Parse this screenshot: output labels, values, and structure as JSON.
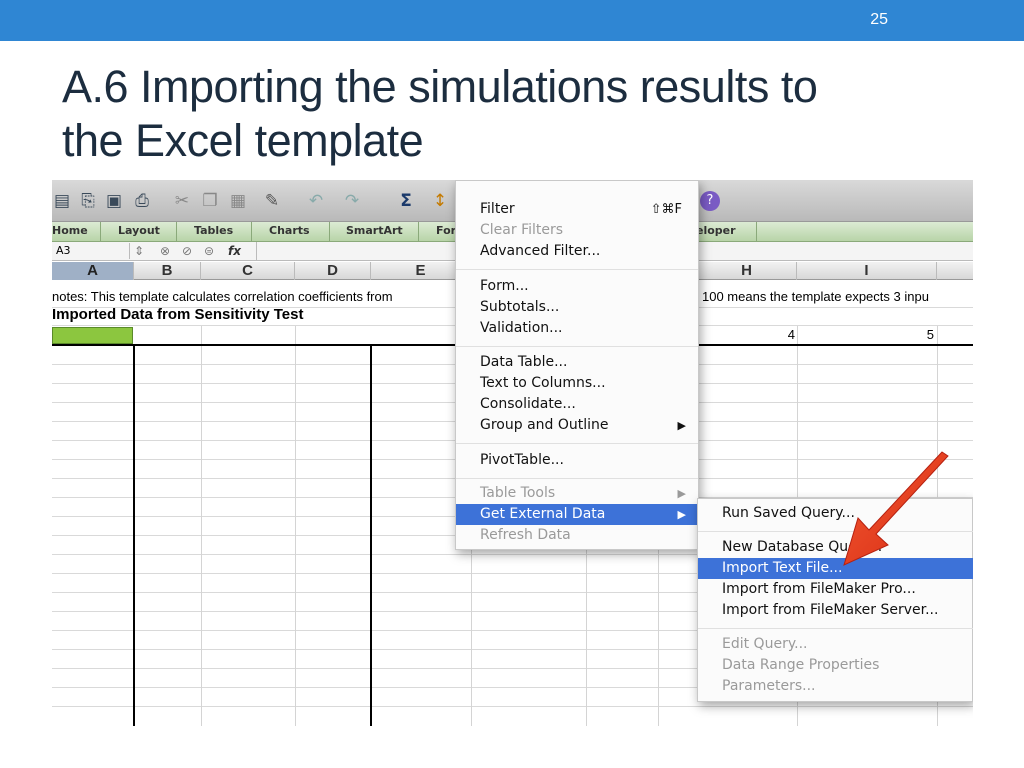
{
  "slide": {
    "number": "25",
    "title_line1": "A.6 Importing the simulations results to",
    "title_line2": "the Excel template",
    "accent_color": "#2f86d3"
  },
  "toolbar": {
    "icons": [
      "sheet-icon",
      "open-icon",
      "save-icon",
      "print-icon",
      "cut-icon",
      "copy-icon",
      "paste-icon",
      "format-brush-icon",
      "undo-icon",
      "redo-icon",
      "autosum-icon",
      "sort-icon",
      "help-icon"
    ]
  },
  "ribbon": {
    "tabs": [
      "Home",
      "Layout",
      "Tables",
      "Charts",
      "SmartArt",
      "For",
      "eloper"
    ]
  },
  "formula_bar": {
    "name_box": "A3",
    "fx": "fx"
  },
  "sheet": {
    "columns": [
      "A",
      "B",
      "C",
      "D",
      "E",
      "H",
      "I"
    ],
    "selected_column": "A",
    "row1_text": "notes: This template calculates correlation coefficients from",
    "row1_text_right": "100 means the template expects 3 inpu",
    "row2_text": "Imported Data from Sensitivity Test",
    "row3_values": [
      "4",
      "5"
    ],
    "selected_cell_color": "#8cc63f"
  },
  "data_menu": {
    "items": [
      {
        "label": "Filter",
        "shortcut": "⇧⌘F",
        "disabled": false
      },
      {
        "label": "Clear Filters",
        "disabled": true
      },
      {
        "label": "Advanced Filter...",
        "disabled": false
      },
      {
        "label": "Form...",
        "disabled": false
      },
      {
        "label": "Subtotals...",
        "disabled": false
      },
      {
        "label": "Validation...",
        "disabled": false
      },
      {
        "label": "Data Table...",
        "disabled": false
      },
      {
        "label": "Text to Columns...",
        "disabled": false
      },
      {
        "label": "Consolidate...",
        "disabled": false
      },
      {
        "label": "Group and Outline",
        "submenu": true,
        "disabled": false
      },
      {
        "label": "PivotTable...",
        "disabled": false
      },
      {
        "label": "Table Tools",
        "submenu": true,
        "disabled": true
      },
      {
        "label": "Get External Data",
        "submenu": true,
        "highlighted": true
      },
      {
        "label": "Refresh Data",
        "disabled": true
      }
    ],
    "arrow_glyph": "▶"
  },
  "submenu": {
    "items": [
      {
        "label": "Run Saved Query...",
        "disabled": false
      },
      {
        "label": "New Database Query...",
        "disabled": false
      },
      {
        "label": "Import Text File...",
        "highlighted": true
      },
      {
        "label": "Import from FileMaker Pro...",
        "disabled": false
      },
      {
        "label": "Import from FileMaker Server...",
        "disabled": false
      },
      {
        "label": "Edit Query...",
        "disabled": true
      },
      {
        "label": "Data Range Properties",
        "disabled": true
      },
      {
        "label": "Parameters...",
        "disabled": true
      }
    ]
  },
  "annotation": {
    "arrow_color": "#e8381c"
  }
}
